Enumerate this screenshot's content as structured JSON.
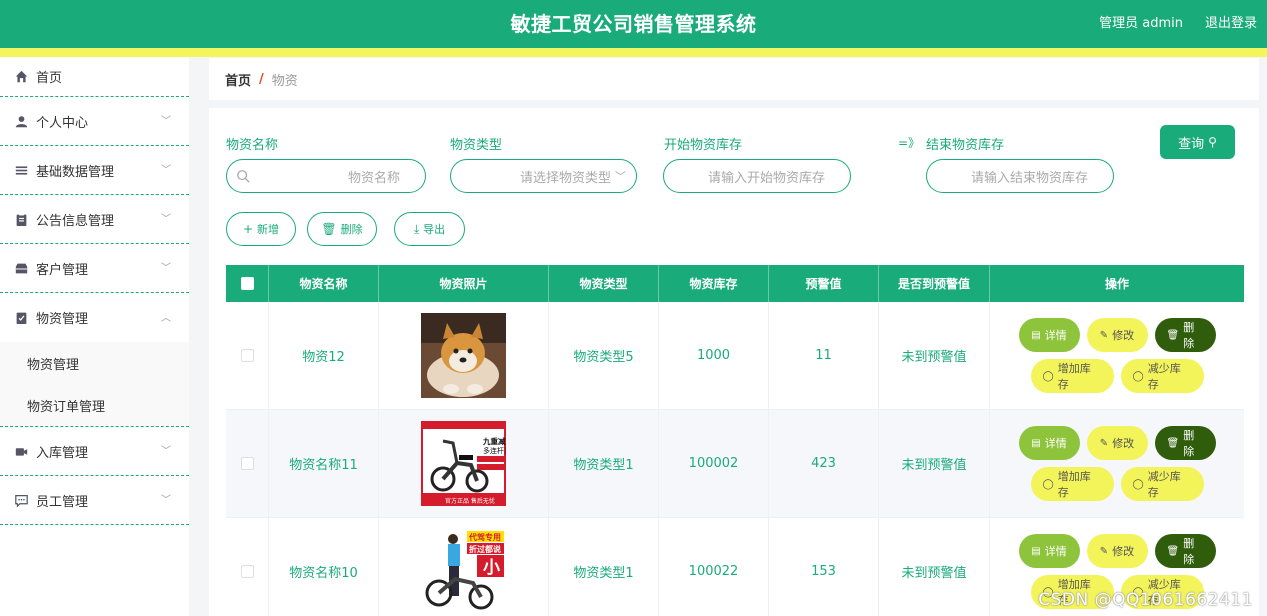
{
  "header": {
    "title": "敏捷工贸公司销售管理系统",
    "user": "管理员 admin",
    "logout": "退出登录",
    "bg_color": "#1aab7a",
    "strip_color": "#f2f55c"
  },
  "sidebar": {
    "items": [
      {
        "label": "首页",
        "icon": "home-icon"
      },
      {
        "label": "个人中心",
        "icon": "user-icon"
      },
      {
        "label": "基础数据管理",
        "icon": "list-icon"
      },
      {
        "label": "公告信息管理",
        "icon": "clipboard-icon"
      },
      {
        "label": "客户管理",
        "icon": "inbox-icon"
      },
      {
        "label": "物资管理",
        "icon": "checklist-icon",
        "expanded": true
      },
      {
        "label": "入库管理",
        "icon": "camera-icon"
      },
      {
        "label": "员工管理",
        "icon": "chat-icon"
      }
    ],
    "submenu": [
      "物资管理",
      "物资订单管理"
    ]
  },
  "breadcrumb": {
    "home": "首页",
    "sep": "/",
    "current": "物资"
  },
  "filters": {
    "name_label": "物资名称",
    "name_placeholder": "物资名称",
    "type_label": "物资类型",
    "type_placeholder": "请选择物资类型",
    "start_label": "开始物资库存",
    "start_placeholder": "请输入开始物资库存",
    "arrow": "=》",
    "end_label": "结束物资库存",
    "end_placeholder": "请输入结束物资库存",
    "query": "查询"
  },
  "actions": {
    "add": "新增",
    "delete": "删除",
    "export": "导出"
  },
  "table": {
    "headers": [
      "物资名称",
      "物资照片",
      "物资类型",
      "物资库存",
      "预警值",
      "是否到预警值",
      "操作"
    ],
    "rows": [
      {
        "name": "物资12",
        "photo": "dog-photo",
        "type": "物资类型5",
        "stock": "1000",
        "warn": "11",
        "reached": "未到预警值"
      },
      {
        "name": "物资名称11",
        "photo": "ebike-ad-photo",
        "type": "物资类型1",
        "stock": "100002",
        "warn": "423",
        "reached": "未到预警值"
      },
      {
        "name": "物资名称10",
        "photo": "ebike-rider-photo",
        "type": "物资类型1",
        "stock": "100022",
        "warn": "153",
        "reached": "未到预警值"
      }
    ],
    "ops": {
      "detail": "详情",
      "edit": "修改",
      "del": "删除",
      "inc": "增加库存",
      "dec": "减少库存"
    }
  },
  "photo_texts": {
    "ad_top": "九重减震",
    "ad_sub": "多连杆液压",
    "ad_bottom": "官方正品 售后无忧",
    "rider_top": "代驾专用",
    "rider_sub": "折过都说",
    "rider_big": "小"
  },
  "watermark": "CSDN @QQ1061662411"
}
